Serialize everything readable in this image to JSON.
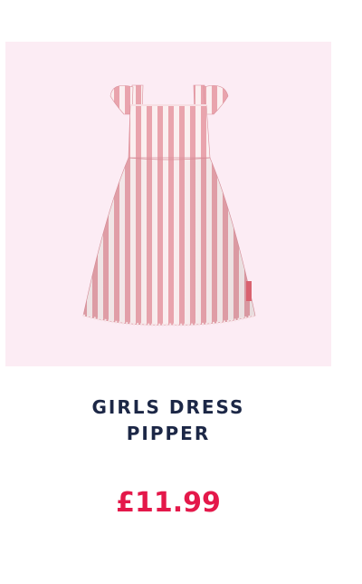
{
  "product": {
    "title_line1": "GIRLS DRESS",
    "title_line2": "PIPPER",
    "price": "£11.99",
    "image_alt": "Pink and white striped girls dress with flutter sleeves"
  },
  "colors": {
    "image_background": "#fcecf4",
    "stripe_pink": "#e9a4ad",
    "stripe_white": "#fbeff0",
    "title": "#1c2746",
    "price": "#e4184a"
  }
}
